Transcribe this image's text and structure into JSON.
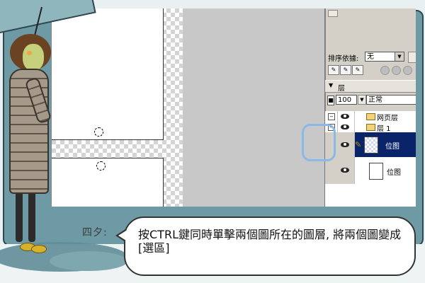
{
  "panel": {
    "sort_label": "排序依據:",
    "sort_value": "无",
    "layers_tab_label": "层",
    "opacity_value": "100",
    "blend_mode": "正常",
    "layers": [
      {
        "name": "网页层"
      },
      {
        "name": "层 1"
      },
      {
        "name": "位图"
      },
      {
        "name": "位图"
      }
    ]
  },
  "caption": {
    "speaker": "四夕:",
    "text": "按CTRL鍵同時單擊兩個圖所在的圖層, 將兩個圖變成[選區]"
  },
  "colors": {
    "selected_row": "#0a246a",
    "panel_bg": "#d4d0c8",
    "highlight_ring": "#8ab8e8",
    "backdrop": "#6e9aa6"
  },
  "icons": [
    "umbrella-illustration",
    "eye-icon",
    "folder-icon",
    "pencil-icon",
    "dropdown-arrow-icon",
    "collapse-icon"
  ]
}
